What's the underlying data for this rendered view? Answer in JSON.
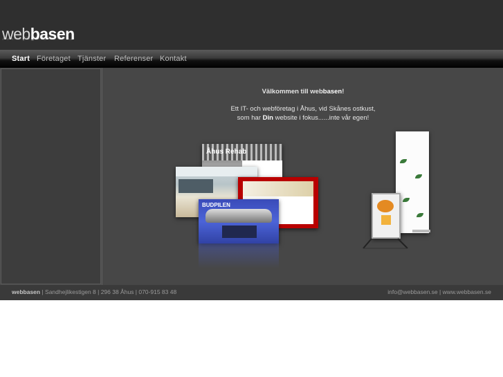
{
  "logo": {
    "part1": "web",
    "part2": "basen"
  },
  "nav": {
    "items": [
      {
        "label": "Start",
        "active": true
      },
      {
        "label": "Företaget",
        "active": false
      },
      {
        "label": "Tjänster",
        "active": false
      },
      {
        "label": "Referenser",
        "active": false
      },
      {
        "label": "Kontakt",
        "active": false
      }
    ]
  },
  "welcome": {
    "title_prefix": "Välkommen till web",
    "title_brand": "basen",
    "title_suffix": "!",
    "line1": "Ett IT- och webföretag i Åhus, vid Skånes ostkust,",
    "line2_prefix": "som har ",
    "line2_bold": "Din",
    "line2_suffix": " website i fokus......inte vår egen!"
  },
  "shots": {
    "shot1_title": "Åhus Rehab",
    "shot4_title": "BUDPILEN"
  },
  "footer": {
    "company": "webbasen",
    "address": " | Sandhejlikestigen 8 | 296 38 Åhus | 070-915 83 48",
    "email": "info@webbasen.se",
    "separator": " | ",
    "website": "www.webbasen.se"
  },
  "colors": {
    "header_bg": "#2f2f2f",
    "content_bg": "#474747",
    "accent_red": "#b90000",
    "accent_blue": "#4c64d8"
  }
}
